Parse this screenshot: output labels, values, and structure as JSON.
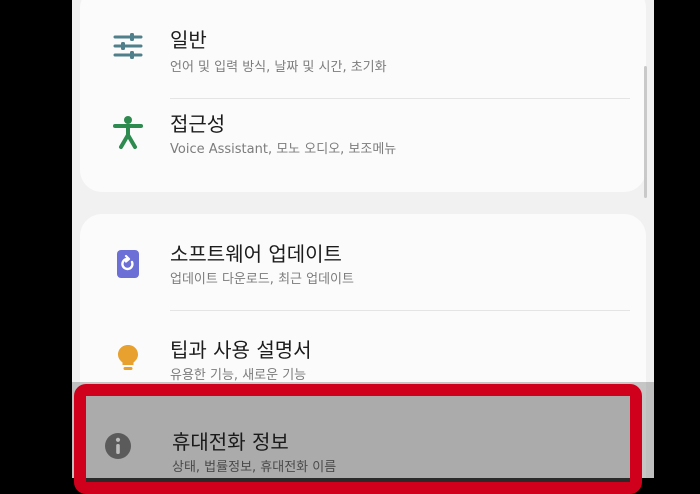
{
  "settings": {
    "items": [
      {
        "title": "일반",
        "subtitle": "언어 및 입력 방식, 날짜 및 시간, 초기화",
        "icon": "sliders-icon"
      },
      {
        "title": "접근성",
        "subtitle": "Voice Assistant, 모노 오디오, 보조메뉴",
        "icon": "accessibility-person-icon"
      },
      {
        "title": "소프트웨어 업데이트",
        "subtitle": "업데이트 다운로드, 최근 업데이트",
        "icon": "update-refresh-icon"
      },
      {
        "title": "팁과 사용 설명서",
        "subtitle": "유용한 기능, 새로운 기능",
        "icon": "lightbulb-icon"
      },
      {
        "title": "휴대전화 정보",
        "subtitle": "상태, 법률정보, 휴대전화 이름",
        "icon": "info-icon"
      }
    ]
  },
  "colors": {
    "highlight_border": "#d0001c",
    "accessibility_green": "#2e8b4f",
    "update_purple": "#6b6fd6",
    "tips_orange": "#e8a02f",
    "sliders_teal": "#4f7f8a"
  }
}
